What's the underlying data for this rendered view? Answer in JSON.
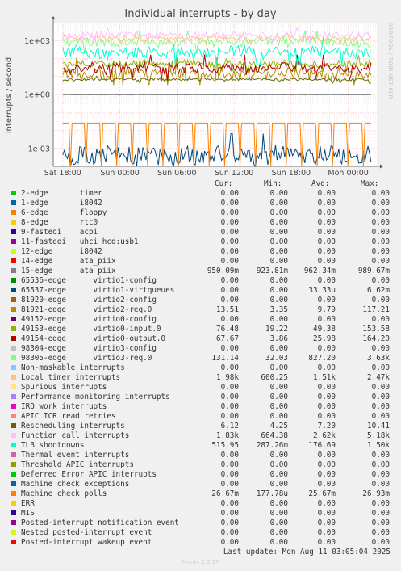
{
  "side_label": "RRDTOOL / TOBI OETIKER",
  "footer": {
    "last_update": "Last update: Mon Aug 11 03:05:04 2025",
    "version": "Munin 2.0.57"
  },
  "legend_header": {
    "cur": "Cur:",
    "min": "Min:",
    "avg": "Avg:",
    "max": "Max:"
  },
  "chart_data": {
    "type": "line",
    "title": "Individual interrupts - by day",
    "ylabel": "interrupts / second",
    "y_scale": "log",
    "ylim": [
      0.0001,
      10000
    ],
    "y_ticks": [
      {
        "v": 1000,
        "label": "1e+03"
      },
      {
        "v": 1,
        "label": "1e+00"
      },
      {
        "v": 0.001,
        "label": "1e-03"
      }
    ],
    "x_ticks": [
      {
        "h": 0,
        "label": "Sat 18:00"
      },
      {
        "h": 6,
        "label": "Sun 00:00"
      },
      {
        "h": 12,
        "label": "Sun 06:00"
      },
      {
        "h": 18,
        "label": "Sun 12:00"
      },
      {
        "h": 24,
        "label": "Sun 18:00"
      },
      {
        "h": 30,
        "label": "Mon 00:00"
      }
    ],
    "x_range_hours": [
      -1,
      33
    ],
    "grid": true,
    "legend_placement": "bottom",
    "series": [
      {
        "name": "2-edge       timer",
        "color": "#00cc00",
        "cur": "0.00",
        "min": "0.00",
        "avg": "0.00",
        "max": "0.00"
      },
      {
        "name": "1-edge       i8042",
        "color": "#0066b3",
        "cur": "0.00",
        "min": "0.00",
        "avg": "0.00",
        "max": "0.00"
      },
      {
        "name": "6-edge       floppy",
        "color": "#ff8000",
        "cur": "0.00",
        "min": "0.00",
        "avg": "0.00",
        "max": "0.00"
      },
      {
        "name": "8-edge       rtc0",
        "color": "#ffcc00",
        "cur": "0.00",
        "min": "0.00",
        "avg": "0.00",
        "max": "0.00"
      },
      {
        "name": "9-fasteoi    acpi",
        "color": "#330099",
        "cur": "0.00",
        "min": "0.00",
        "avg": "0.00",
        "max": "0.00"
      },
      {
        "name": "11-fasteoi   uhci_hcd:usb1",
        "color": "#990099",
        "cur": "0.00",
        "min": "0.00",
        "avg": "0.00",
        "max": "0.00"
      },
      {
        "name": "12-edge      i8042",
        "color": "#ccff00",
        "cur": "0.00",
        "min": "0.00",
        "avg": "0.00",
        "max": "0.00"
      },
      {
        "name": "14-edge      ata_piix",
        "color": "#ff0000",
        "cur": "0.00",
        "min": "0.00",
        "avg": "0.00",
        "max": "0.00"
      },
      {
        "name": "15-edge      ata_piix",
        "color": "#808080",
        "cur": "950.09m",
        "min": "923.81m",
        "avg": "962.34m",
        "max": "989.67m"
      },
      {
        "name": "65536-edge      virtio1-config",
        "color": "#008f00",
        "cur": "0.00",
        "min": "0.00",
        "avg": "0.00",
        "max": "0.00"
      },
      {
        "name": "65537-edge      virtio1-virtqueues",
        "color": "#00487d",
        "cur": "0.00",
        "min": "0.00",
        "avg": "33.33u",
        "max": "6.62m"
      },
      {
        "name": "81920-edge      virtio2-config",
        "color": "#b35a00",
        "cur": "0.00",
        "min": "0.00",
        "avg": "0.00",
        "max": "0.00"
      },
      {
        "name": "81921-edge      virtio2-req.0",
        "color": "#b38f00",
        "cur": "13.51",
        "min": "3.35",
        "avg": "9.79",
        "max": "117.21"
      },
      {
        "name": "49152-edge      virtio0-config",
        "color": "#6b006b",
        "cur": "0.00",
        "min": "0.00",
        "avg": "0.00",
        "max": "0.00"
      },
      {
        "name": "49153-edge      virtio0-input.0",
        "color": "#8fb300",
        "cur": "76.48",
        "min": "19.22",
        "avg": "49.38",
        "max": "153.58"
      },
      {
        "name": "49154-edge      virtio0-output.0",
        "color": "#b30000",
        "cur": "67.67",
        "min": "3.86",
        "avg": "25.98",
        "max": "164.20"
      },
      {
        "name": "98304-edge      virtio3-config",
        "color": "#bebebe",
        "cur": "0.00",
        "min": "0.00",
        "avg": "0.00",
        "max": "0.00"
      },
      {
        "name": "98305-edge      virtio3-req.0",
        "color": "#80ff80",
        "cur": "131.14",
        "min": "32.03",
        "avg": "827.20",
        "max": "3.63k"
      },
      {
        "name": "Non-maskable interrupts",
        "color": "#80c9ff",
        "cur": "0.00",
        "min": "0.00",
        "avg": "0.00",
        "max": "0.00"
      },
      {
        "name": "Local timer interrupts",
        "color": "#ffc080",
        "cur": "1.98k",
        "min": "600.25",
        "avg": "1.51k",
        "max": "2.47k"
      },
      {
        "name": "Spurious interrupts",
        "color": "#ffe680",
        "cur": "0.00",
        "min": "0.00",
        "avg": "0.00",
        "max": "0.00"
      },
      {
        "name": "Performance monitoring interrupts",
        "color": "#aa80ff",
        "cur": "0.00",
        "min": "0.00",
        "avg": "0.00",
        "max": "0.00"
      },
      {
        "name": "IRQ work interrupts",
        "color": "#ee00cc",
        "cur": "0.00",
        "min": "0.00",
        "avg": "0.00",
        "max": "0.00"
      },
      {
        "name": "APIC ICR read retries",
        "color": "#ff8080",
        "cur": "0.00",
        "min": "0.00",
        "avg": "0.00",
        "max": "0.00"
      },
      {
        "name": "Rescheduling interrupts",
        "color": "#666600",
        "cur": "6.12",
        "min": "4.25",
        "avg": "7.20",
        "max": "10.41"
      },
      {
        "name": "Function call interrupts",
        "color": "#ffbfff",
        "cur": "1.83k",
        "min": "664.38",
        "avg": "2.62k",
        "max": "5.18k"
      },
      {
        "name": "TLB shootdowns",
        "color": "#00ffcc",
        "cur": "515.95",
        "min": "287.26m",
        "avg": "176.69",
        "max": "1.50k"
      },
      {
        "name": "Thermal event interrupts",
        "color": "#cc6699",
        "cur": "0.00",
        "min": "0.00",
        "avg": "0.00",
        "max": "0.00"
      },
      {
        "name": "Threshold APIC interrupts",
        "color": "#999900",
        "cur": "0.00",
        "min": "0.00",
        "avg": "0.00",
        "max": "0.00"
      },
      {
        "name": "Deferred Error APIC interrupts",
        "color": "#00cc00",
        "cur": "0.00",
        "min": "0.00",
        "avg": "0.00",
        "max": "0.00"
      },
      {
        "name": "Machine check exceptions",
        "color": "#0066b3",
        "cur": "0.00",
        "min": "0.00",
        "avg": "0.00",
        "max": "0.00"
      },
      {
        "name": "Machine check polls",
        "color": "#ff8000",
        "cur": "26.67m",
        "min": "177.78u",
        "avg": "25.67m",
        "max": "26.93m"
      },
      {
        "name": "ERR",
        "color": "#ffcc00",
        "cur": "0.00",
        "min": "0.00",
        "avg": "0.00",
        "max": "0.00"
      },
      {
        "name": "MIS",
        "color": "#330099",
        "cur": "0.00",
        "min": "0.00",
        "avg": "0.00",
        "max": "0.00"
      },
      {
        "name": "Posted-interrupt notification event",
        "color": "#990099",
        "cur": "0.00",
        "min": "0.00",
        "avg": "0.00",
        "max": "0.00"
      },
      {
        "name": "Nested posted-interrupt event",
        "color": "#ccff00",
        "cur": "0.00",
        "min": "0.00",
        "avg": "0.00",
        "max": "0.00"
      },
      {
        "name": "Posted-interrupt wakeup event",
        "color": "#ff0000",
        "cur": "0.00",
        "min": "0.00",
        "avg": "0.00",
        "max": "0.00"
      }
    ]
  }
}
